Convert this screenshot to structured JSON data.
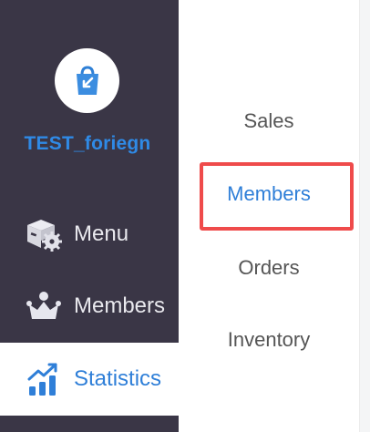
{
  "store": {
    "name": "TEST_foriegn",
    "logo_icon": "shopping-bag-icon"
  },
  "sidebar": {
    "items": [
      {
        "label": "Menu",
        "icon": "box-gear-icon",
        "active": false
      },
      {
        "label": "Members",
        "icon": "crown-icon",
        "active": false
      },
      {
        "label": "Statistics",
        "icon": "bar-chart-icon",
        "active": true
      }
    ]
  },
  "subnav": {
    "items": [
      {
        "label": "Sales",
        "active": false
      },
      {
        "label": "Members",
        "active": true
      },
      {
        "label": "Orders",
        "active": false
      },
      {
        "label": "Inventory",
        "active": false
      }
    ]
  },
  "colors": {
    "sidebar_bg": "#3a3646",
    "accent": "#2f7fd8",
    "highlight": "#ef4b4b"
  }
}
